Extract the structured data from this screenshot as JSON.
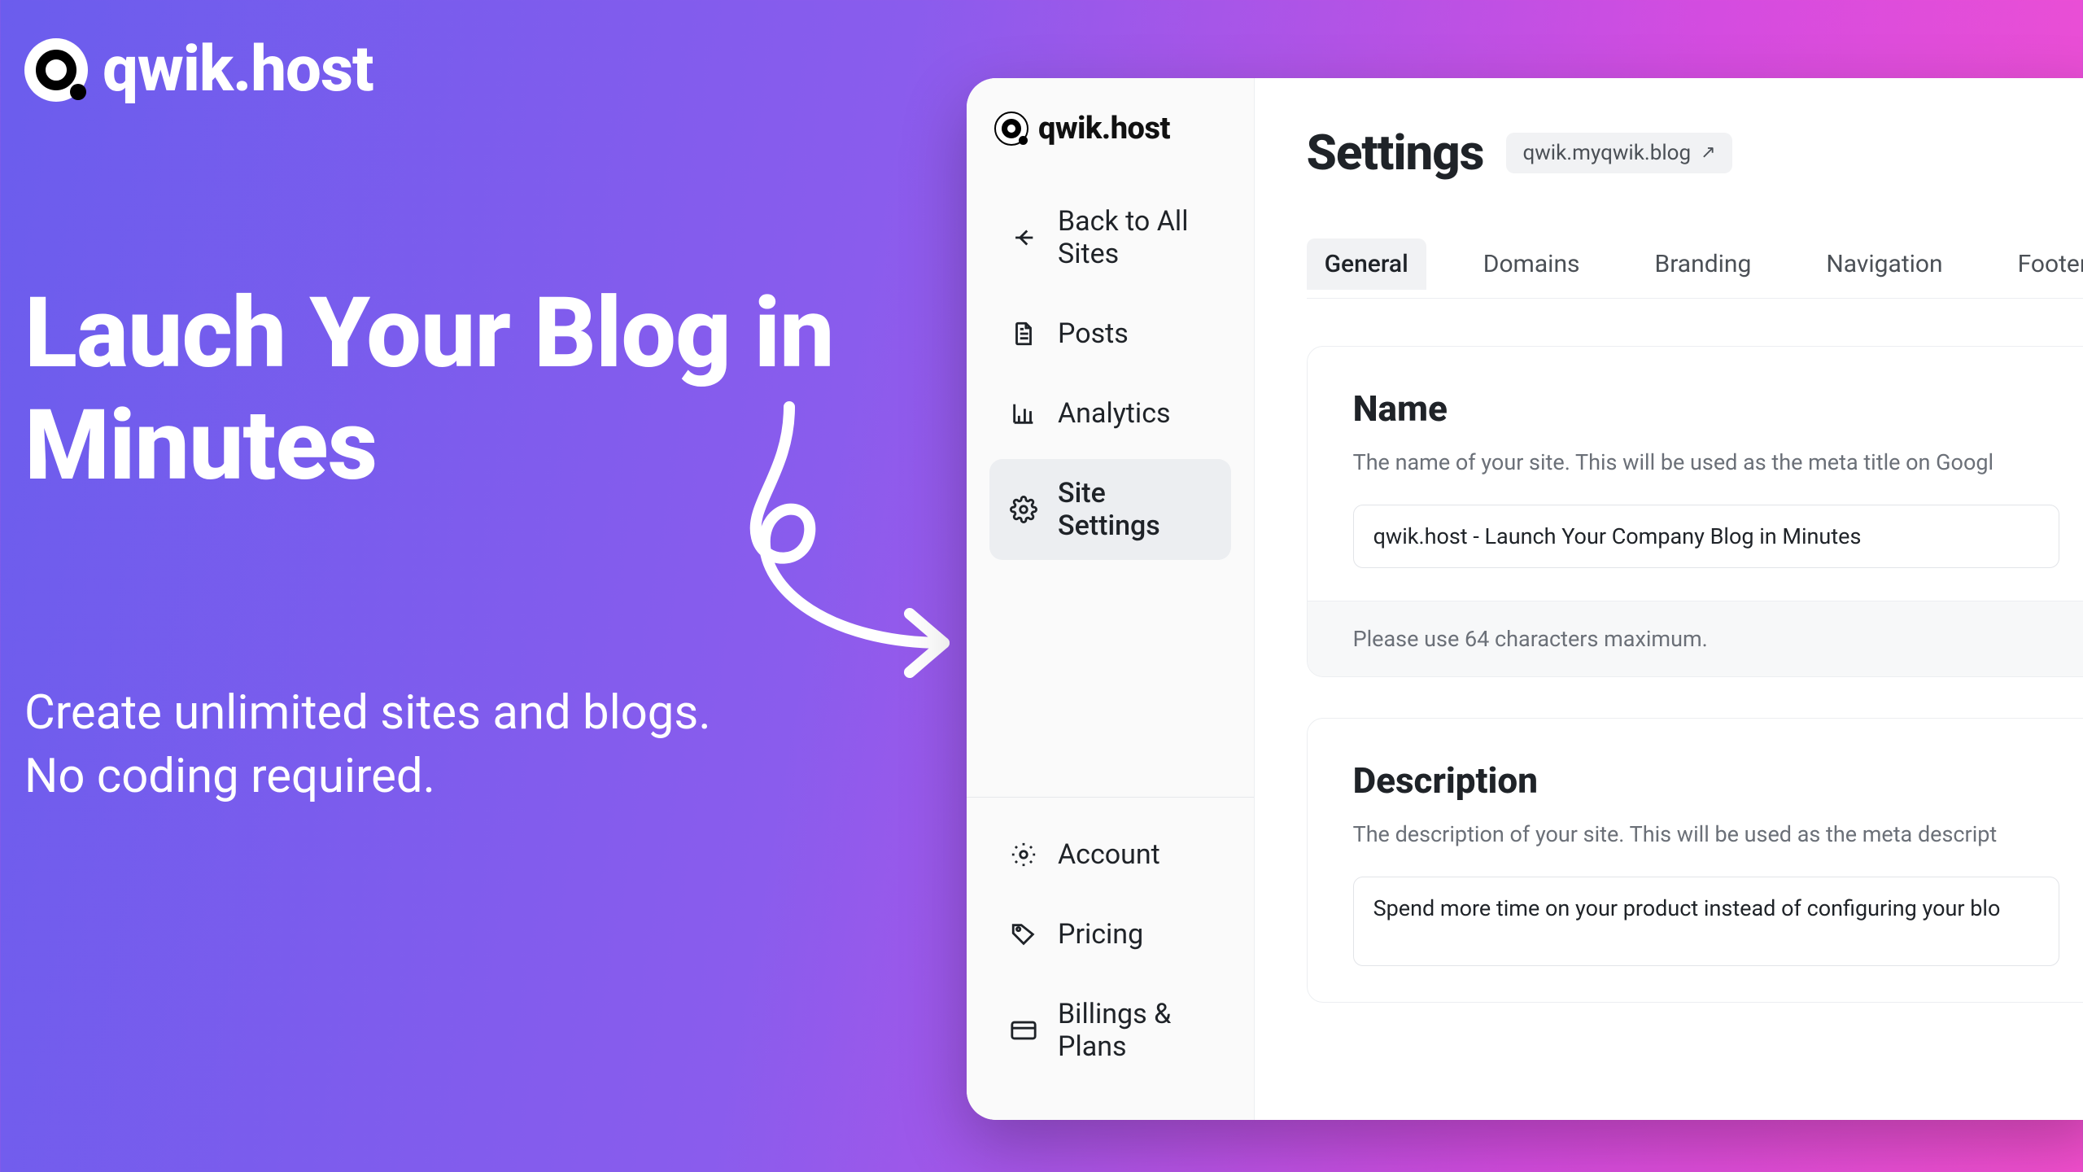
{
  "brand": "qwik.host",
  "hero": {
    "title": "Lauch Your Blog in Minutes",
    "sub_line1": "Create unlimited sites and blogs.",
    "sub_line2": "No coding required."
  },
  "sidebar": {
    "items": [
      {
        "label": "Back to All Sites"
      },
      {
        "label": "Posts"
      },
      {
        "label": "Analytics"
      },
      {
        "label": "Site Settings"
      }
    ],
    "footer_items": [
      {
        "label": "Account"
      },
      {
        "label": "Pricing"
      },
      {
        "label": "Billings & Plans"
      }
    ]
  },
  "main": {
    "page_title": "Settings",
    "site_url": "qwik.myqwik.blog",
    "tabs": [
      {
        "label": "General"
      },
      {
        "label": "Domains"
      },
      {
        "label": "Branding"
      },
      {
        "label": "Navigation"
      },
      {
        "label": "Footer"
      }
    ],
    "name_card": {
      "heading": "Name",
      "help": "The name of your site. This will be used as the meta title on Googl",
      "value": "qwik.host - Launch Your Company Blog in Minutes",
      "footer": "Please use 64 characters maximum."
    },
    "desc_card": {
      "heading": "Description",
      "help": "The description of your site. This will be used as the meta descript",
      "value": "Spend more time on your product instead of configuring your blo"
    }
  }
}
